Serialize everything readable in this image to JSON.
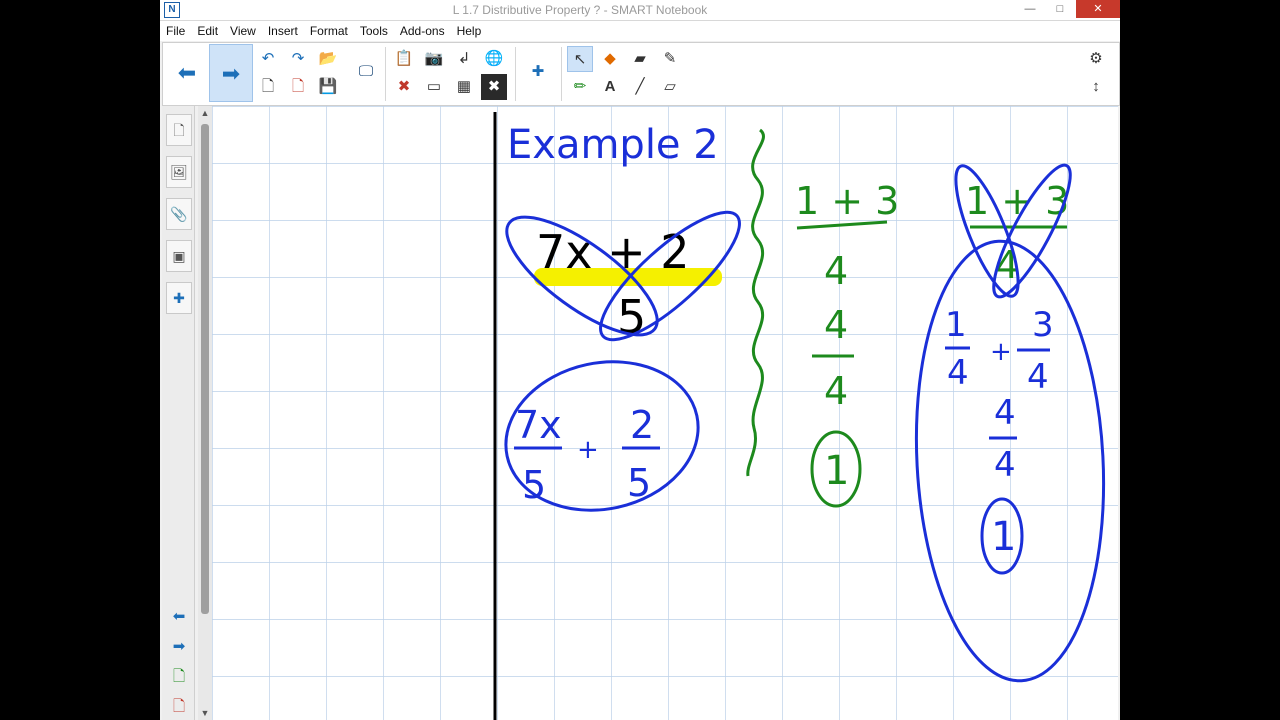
{
  "window": {
    "title": "L 1.7 Distributive Property ? - SMART Notebook",
    "minimize": "—",
    "maximize": "□",
    "close": "✕"
  },
  "menu": [
    "File",
    "Edit",
    "View",
    "Insert",
    "Format",
    "Tools",
    "Add-ons",
    "Help"
  ],
  "toolbar": {
    "icons": [
      "back-arrow-icon",
      "forward-arrow-icon",
      "undo-icon",
      "redo-icon",
      "open-file-icon",
      "new-page-icon",
      "delete-page-icon",
      "save-icon",
      "screen-shade-icon",
      "paste-icon",
      "delete-icon",
      "screen-capture-icon",
      "document-camera-icon",
      "table-icon",
      "full-screen-icon",
      "addons-icon",
      "select-pointer-icon",
      "fill-icon",
      "eraser-icon",
      "magic-pen-icon",
      "pens-icon",
      "text-icon",
      "line-icon",
      "shape-icon",
      "gear-icon",
      "toolbar-move-icon"
    ]
  },
  "sidebar": {
    "tabs": [
      "page-sorter-icon",
      "gallery-icon",
      "attachments-icon",
      "properties-icon",
      "addons-icon"
    ]
  },
  "notebook": {
    "heading": "Example 2",
    "expression": {
      "numerator": "7x + 2",
      "denominator": "5"
    },
    "split": {
      "n1": "7x",
      "d1": "5",
      "plus": "+",
      "n2": "2",
      "d2": "5"
    },
    "middle": {
      "n1": "1 + 3",
      "d1": "4",
      "n2": "4",
      "d2": "4",
      "result": "1"
    },
    "right": {
      "n0": "1 + 3",
      "d0": "4",
      "a_n": "1",
      "a_d": "4",
      "plus": "+",
      "b_n": "3",
      "b_d": "4",
      "c_n": "4",
      "c_d": "4",
      "result": "1"
    },
    "colors": {
      "blue": "#1a2fd8",
      "green": "#1d8a1d",
      "highlight": "#f5f000",
      "ink": "#000000",
      "grid": "#bcd0e8"
    }
  }
}
